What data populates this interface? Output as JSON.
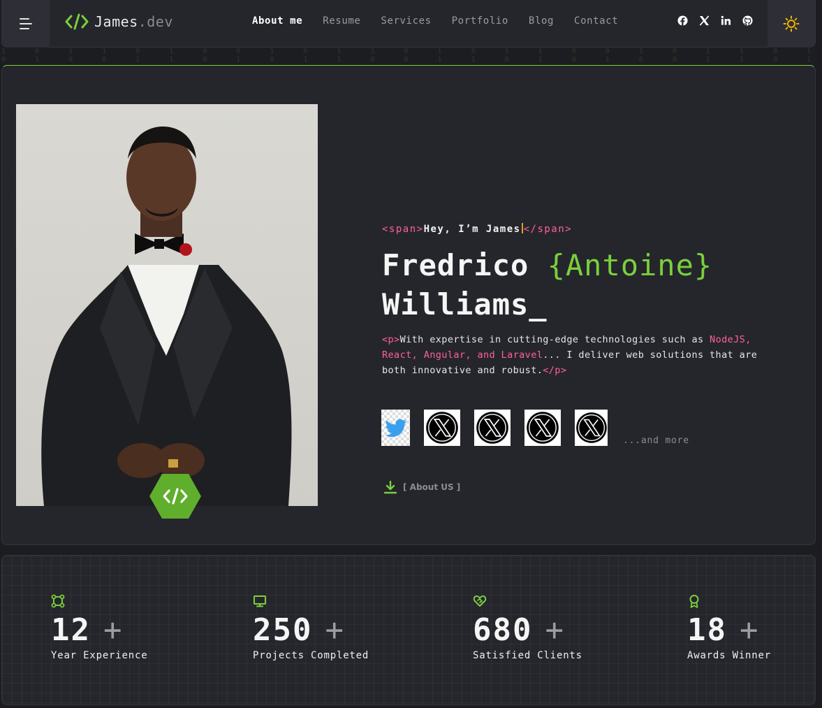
{
  "header": {
    "brand_main": "James",
    "brand_suffix": ".dev",
    "nav": [
      "About me",
      "Resume",
      "Services",
      "Portfolio",
      "Blog",
      "Contact"
    ],
    "active_nav": "About me",
    "socials": [
      "facebook-icon",
      "x-icon",
      "linkedin-icon",
      "github-icon"
    ],
    "theme_icon": "sun-icon"
  },
  "hero": {
    "open_span": "<span>",
    "greeting": "Hey, I’m James",
    "close_span": "</span>",
    "name_first": "Fredrico ",
    "name_middle_open": "{",
    "name_middle": "Antoine",
    "name_middle_close": "}",
    "name_last": "Williams_",
    "p_open": "<p>",
    "desc_1": "With expertise in cutting-edge technologies such as ",
    "desc_hl": "NodeJS, React, Angular, and Laravel",
    "desc_2": "... I deliver web solutions that are both innovative and robust.",
    "p_close": "</p>",
    "and_more": "...and more",
    "about_link": "[ About US ]"
  },
  "stats": [
    {
      "number": "12",
      "plus": "+",
      "label": "Year Experience",
      "icon": "frame-icon"
    },
    {
      "number": "250",
      "plus": "+",
      "label": "Projects Completed",
      "icon": "monitor-icon"
    },
    {
      "number": "680",
      "plus": "+",
      "label": "Satisfied Clients",
      "icon": "heart-handshake-icon"
    },
    {
      "number": "18",
      "plus": "+",
      "label": "Awards Winner",
      "icon": "award-icon"
    }
  ],
  "colors": {
    "accent": "#7ad03a",
    "pink": "#ff5fa2",
    "background": "#1c1d21",
    "panel": "#25262c"
  }
}
